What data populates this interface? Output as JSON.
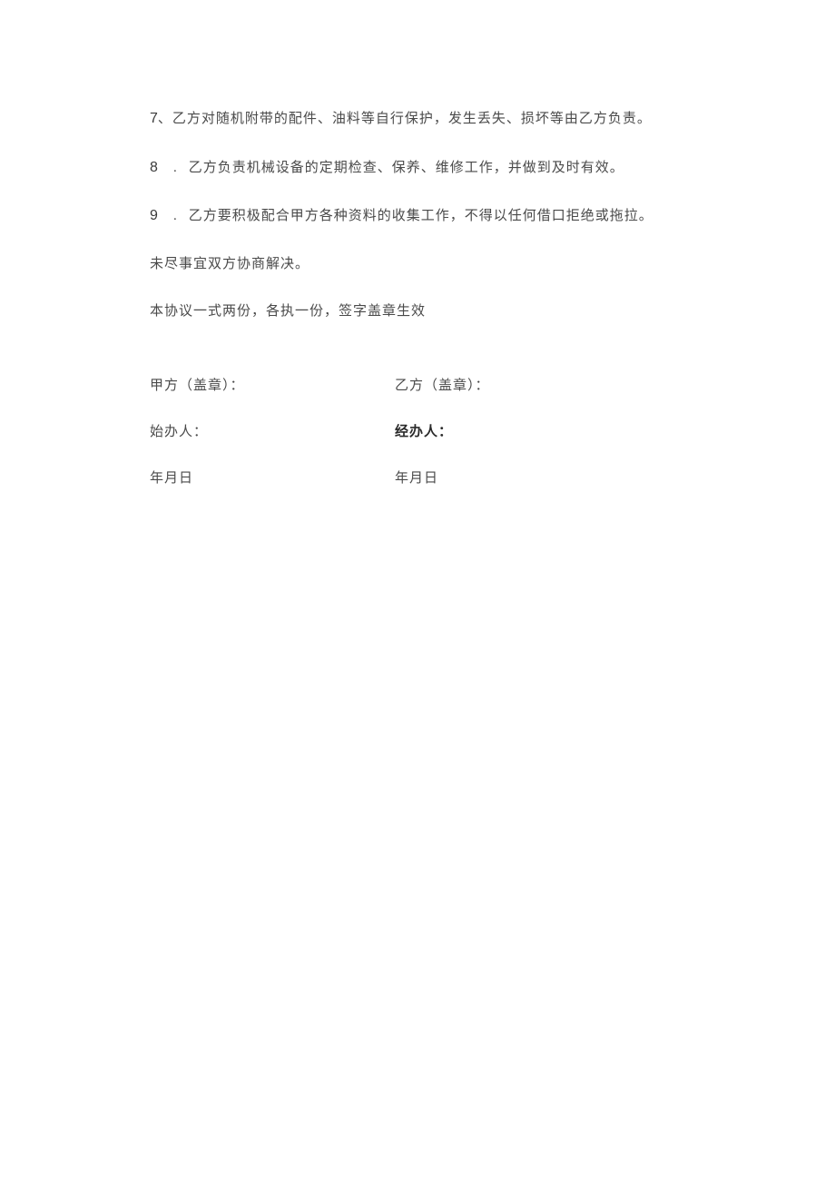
{
  "clauses": {
    "c7": {
      "number": "7",
      "sep": "、",
      "text": "乙方对随机附带的配件、油料等自行保护，发生丢失、损坏等由乙方负责。"
    },
    "c8": {
      "number": "8",
      "sep": ".",
      "text": "乙方负责机械设备的定期检查、保养、维修工作，并做到及时有效。"
    },
    "c9": {
      "number": "9",
      "sep": ".",
      "text": "乙方要积极配合甲方各种资料的收集工作，不得以任何借口拒绝或拖拉。"
    }
  },
  "body": {
    "line1": "未尽事宜双方协商解决。",
    "line2": "本协议一式两份，各执一份，签字盖章生效"
  },
  "signatures": {
    "partyA_seal": "甲方（盖章）：",
    "partyB_seal": "乙方（盖章）：",
    "handlerA": "始办人：",
    "handlerB": "经办人：",
    "dateA": "年月日",
    "dateB": "年月日"
  }
}
